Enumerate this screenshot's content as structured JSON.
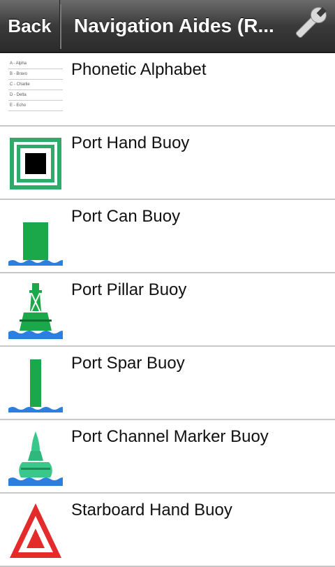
{
  "header": {
    "back_label": "Back",
    "title": "Navigation Aides (R..."
  },
  "list": {
    "items": [
      {
        "label": "Phonetic Alphabet",
        "icon": "phonetic-alphabet-icon"
      },
      {
        "label": "Port Hand Buoy",
        "icon": "port-hand-buoy-icon"
      },
      {
        "label": "Port Can Buoy",
        "icon": "port-can-buoy-icon"
      },
      {
        "label": "Port Pillar Buoy",
        "icon": "port-pillar-buoy-icon"
      },
      {
        "label": "Port Spar Buoy",
        "icon": "port-spar-buoy-icon"
      },
      {
        "label": "Port Channel Marker Buoy",
        "icon": "port-channel-marker-buoy-icon"
      },
      {
        "label": "Starboard Hand Buoy",
        "icon": "starboard-hand-buoy-icon"
      }
    ],
    "phonetic_preview": [
      "A - Alpha",
      "B - Bravo",
      "C - Charlie",
      "D - Delta",
      "E - Echo"
    ]
  },
  "colors": {
    "buoy_green": "#1aa84a",
    "water_blue": "#2a7fe0",
    "starboard_red": "#e32b2b"
  }
}
